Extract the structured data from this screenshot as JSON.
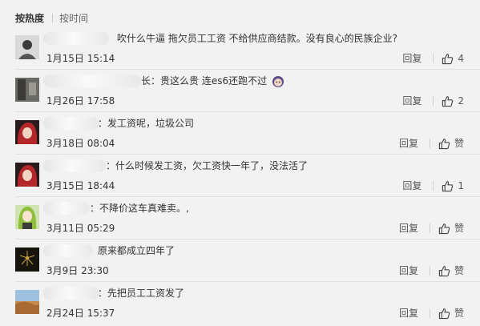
{
  "sort": {
    "active": "按热度",
    "inactive": "按时间"
  },
  "reply_label": "回复",
  "comments": [
    {
      "text": "吹什么牛逼 拖欠员工工资 不给供应商结款。没有良心的民族企业?",
      "time": "1月15日 15:14",
      "likes": "4",
      "avatar_icon": "person-avatar-icon"
    },
    {
      "text": "长：贵这么贵 连es6还跑不过",
      "time": "1月26日 17:58",
      "likes": "2",
      "avatar_icon": "dark-room-avatar-icon"
    },
    {
      "text": "：发工资呢，垃圾公司",
      "time": "3月18日 08:04",
      "likes": "赞",
      "avatar_icon": "red-hair-avatar-icon"
    },
    {
      "text": "：什么时候发工资，欠工资快一年了，没法活了",
      "time": "3月15日 18:44",
      "likes": "1",
      "avatar_icon": "red-hair-avatar-icon"
    },
    {
      "text": "：不降价这车真难卖。,",
      "time": "3月11日 05:29",
      "likes": "赞",
      "avatar_icon": "anime-girl-avatar-icon"
    },
    {
      "text": "原来都成立四年了",
      "time": "3月9日 23:30",
      "likes": "赞",
      "avatar_icon": "fireworks-avatar-icon"
    },
    {
      "text": "：先把员工工资发了",
      "time": "2月24日 15:37",
      "likes": "赞",
      "avatar_icon": "desert-avatar-icon"
    }
  ]
}
